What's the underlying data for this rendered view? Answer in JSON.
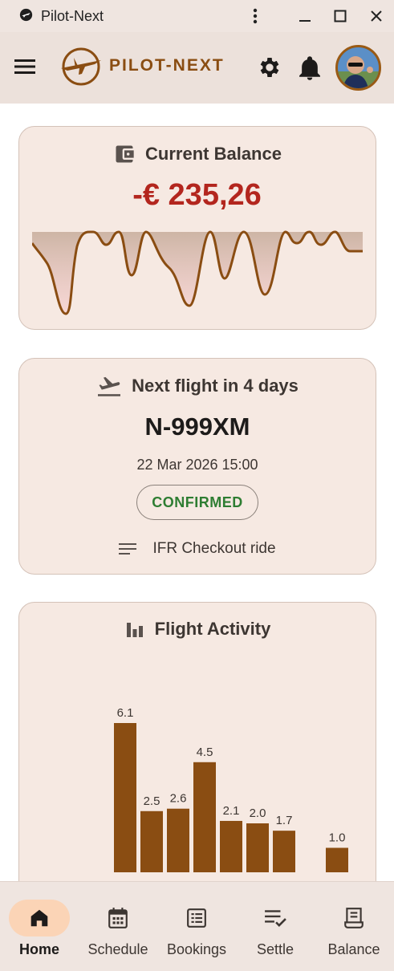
{
  "window": {
    "title": "Pilot-Next"
  },
  "appbar": {
    "brand": "PILOT-NEXT"
  },
  "balance": {
    "title": "Current Balance",
    "amount": "-€ 235,26"
  },
  "next_flight": {
    "title": "Next flight in 4 days",
    "aircraft": "N-999XM",
    "datetime": "22 Mar 2026 15:00",
    "status": "CONFIRMED",
    "notes": "IFR Checkout ride"
  },
  "activity": {
    "title": "Flight Activity"
  },
  "chart_data": {
    "type": "bar",
    "categories": [
      "",
      "",
      "",
      "",
      "",
      "",
      "",
      "",
      ""
    ],
    "values": [
      6.1,
      2.5,
      2.6,
      4.5,
      2.1,
      2.0,
      1.7,
      0,
      1.0
    ],
    "labels": [
      "6.1",
      "2.5",
      "2.6",
      "4.5",
      "2.1",
      "2.0",
      "1.7",
      "",
      "1.0"
    ],
    "ylim": [
      0,
      6.1
    ],
    "title": "Flight Activity",
    "xlabel": "",
    "ylabel": "",
    "grid": false
  },
  "nav": {
    "items": [
      {
        "label": "Home",
        "icon": "home-icon",
        "active": true
      },
      {
        "label": "Schedule",
        "icon": "calendar-icon",
        "active": false
      },
      {
        "label": "Bookings",
        "icon": "list-icon",
        "active": false
      },
      {
        "label": "Settle",
        "icon": "checklist-icon",
        "active": false
      },
      {
        "label": "Balance",
        "icon": "receipt-icon",
        "active": false
      }
    ]
  },
  "colors": {
    "accent": "#8a4d12",
    "negative": "#b3261e",
    "confirmed": "#2e7d32",
    "bar": "#8a4d12"
  }
}
